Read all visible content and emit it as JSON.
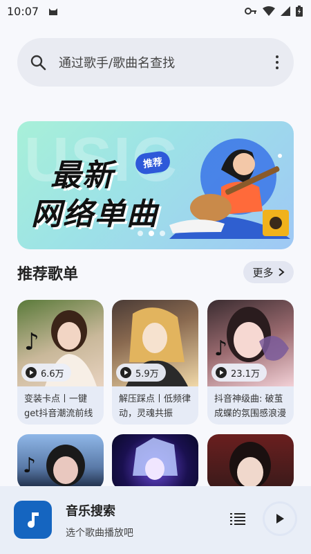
{
  "status_bar": {
    "time": "10:07",
    "icons": [
      "cat-icon",
      "key-icon",
      "wifi-icon",
      "signal-icon",
      "battery-icon"
    ]
  },
  "search": {
    "placeholder": "通过歌手/歌曲名查找",
    "icon": "search-icon",
    "menu_icon": "more-vertical-icon"
  },
  "banner": {
    "watermark": "USIC",
    "title_line1": "最新",
    "title_line2": "网络单曲",
    "badge": "推荐",
    "dots": 3,
    "active_dot": 1
  },
  "section": {
    "title": "推荐歌单",
    "more_label": "更多"
  },
  "playlists": [
    {
      "count": "6.6万",
      "title": "变装卡点丨一键get抖音潮流前线",
      "colors": [
        "#5a7a3a",
        "#c9b89a",
        "#e8d3c0"
      ]
    },
    {
      "count": "5.9万",
      "title": "解压踩点丨低频律动，灵魂共振",
      "colors": [
        "#4a3b36",
        "#d7a45a",
        "#f0d8a8"
      ]
    },
    {
      "count": "23.1万",
      "title": "抖音神级曲: 破茧成蝶的氛围感浪漫",
      "colors": [
        "#3a2c30",
        "#c98b8f",
        "#f2d0d6"
      ]
    },
    {
      "count": "",
      "title": "",
      "colors": [
        "#8fb7e8",
        "#1a2740",
        "#e9c8bf"
      ]
    },
    {
      "count": "",
      "title": "",
      "colors": [
        "#0a0a2a",
        "#6a4ad8",
        "#b8c8ff"
      ]
    },
    {
      "count": "",
      "title": "",
      "colors": [
        "#6a1f1f",
        "#2a1a1a",
        "#f0d8cc"
      ]
    }
  ],
  "player": {
    "title": "音乐搜索",
    "subtitle": "选个歌曲播放吧",
    "cover_icon": "music-note-icon",
    "playlist_icon": "playlist-icon",
    "play_icon": "play-icon",
    "accent": "#1565c0"
  }
}
